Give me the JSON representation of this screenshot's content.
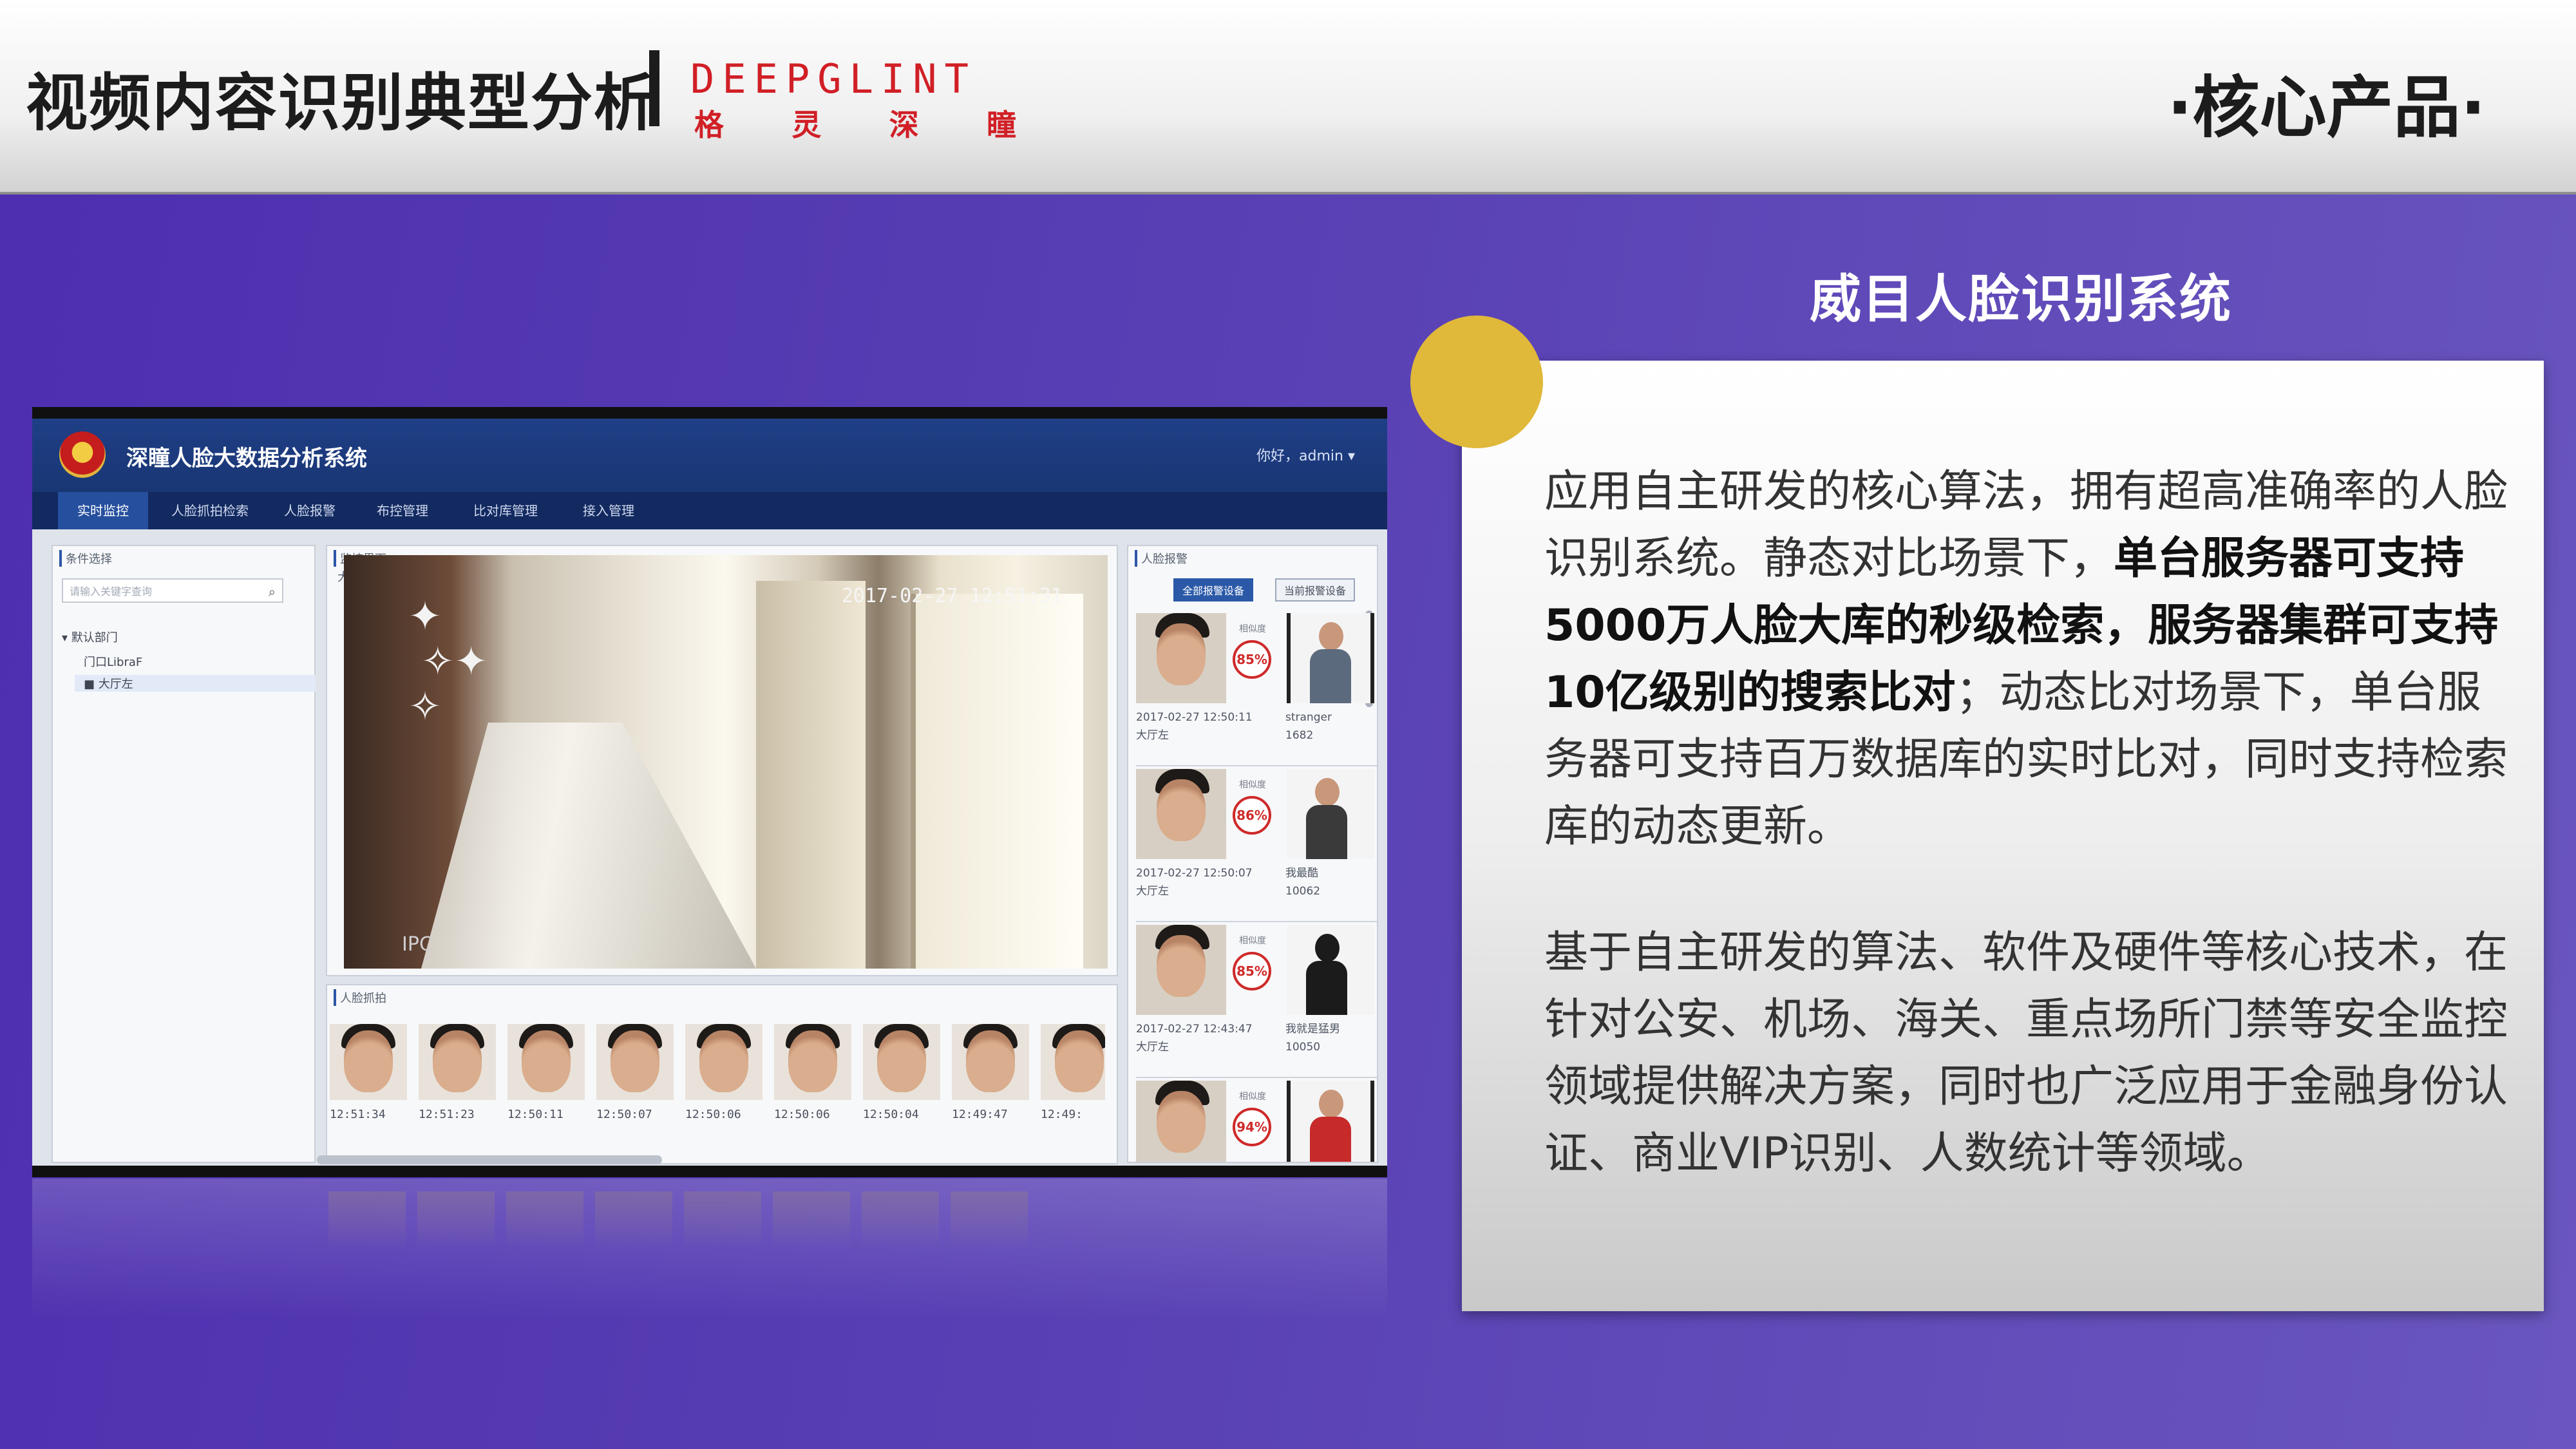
{
  "header": {
    "title": "视频内容识别典型分析",
    "logo_en": "DEEPGLINT",
    "logo_cn": [
      "格",
      "灵",
      "深",
      "瞳"
    ],
    "section": "·核心产品·"
  },
  "screenshot": {
    "app_title": "深瞳人脸大数据分析系统",
    "user": "你好，admin ▾",
    "nav": [
      "实时监控",
      "人脸抓拍检索",
      "人脸报警",
      "布控管理",
      "比对库管理",
      "接入管理"
    ],
    "left_panel": {
      "title": "条件选择",
      "search_placeholder": "请输入关键字查询",
      "tree": [
        "▾ 默认部门",
        "门口LibraF",
        "■ 大厅左"
      ]
    },
    "video_panel": {
      "title": "监控界面",
      "camera": "大厅左",
      "timestamp": "2017-02-27 12:51:31",
      "corner": "IPC"
    },
    "face_panel": {
      "title": "人脸抓拍",
      "times": [
        "12:51:34",
        "12:51:23",
        "12:50:11",
        "12:50:07",
        "12:50:06",
        "12:50:06",
        "12:50:04",
        "12:49:47",
        "12:49:"
      ]
    },
    "alarm_panel": {
      "title": "人脸报警",
      "tabs": [
        "全部报警设备",
        "当前报警设备"
      ],
      "similarity_label": "相似度",
      "rows": [
        {
          "score": "85%",
          "time": "2017-02-27 12:50:11",
          "place": "大厅左",
          "name": "stranger",
          "id": "1682"
        },
        {
          "score": "86%",
          "time": "2017-02-27 12:50:07",
          "place": "大厅左",
          "name": "我最酷",
          "id": "10062"
        },
        {
          "score": "85%",
          "time": "2017-02-27 12:43:47",
          "place": "大厅左",
          "name": "我就是猛男",
          "id": "10050"
        },
        {
          "score": "94%",
          "time": "",
          "place": "",
          "name": "",
          "id": ""
        }
      ]
    }
  },
  "product": {
    "title": "威目人脸识别系统",
    "para1_a": "应用自主研发的核心算法，拥有超高准确率的人脸识别系统。静态对比场景下，",
    "para1_b": "单台服务器可支持5000万人脸大库的秒级检索，服务器集群可支持10亿级别的搜索比对",
    "para1_c": "；动态比对场景下，单台服务器可支持百万数据库的实时比对，同时支持检索库的动态更新。",
    "para2": "基于自主研发的算法、软件及硬件等核心技术，在针对公安、机场、海关、重点场所门禁等安全监控领域提供解决方案，同时也广泛应用于金融身份认证、商业VIP识别、人数统计等领域。"
  },
  "colors": {
    "accent_red": "#d11f26",
    "background_purple": "#5a42b5",
    "gold": "#e0b83a"
  }
}
